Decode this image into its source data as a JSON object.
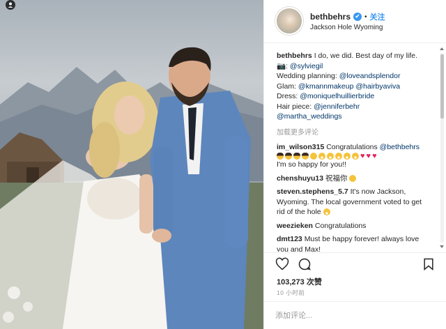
{
  "post": {
    "username": "bethbehrs",
    "verified_mark": "✔",
    "separator": "•",
    "follow_label": "关注",
    "location": "Jackson Hole Wyoming"
  },
  "caption": {
    "username": "bethbehrs",
    "text": "I do, we did. Best day of my life.",
    "camera_emoji": "📷",
    "lines": [
      {
        "prefix": "📷: ",
        "link": "@sylviegil"
      },
      {
        "prefix": "Wedding planning: ",
        "link": "@loveandsplendor"
      },
      {
        "prefix": "Glam: ",
        "link": "@kmannmakeup @hairbyaviva"
      },
      {
        "prefix": "Dress: ",
        "link": "@moniquelhuillierbride"
      },
      {
        "prefix": "Hair piece: ",
        "link": "@jenniferbehr"
      },
      {
        "prefix": "",
        "link": "@martha_weddings"
      }
    ]
  },
  "load_more_label": "加载更多评论",
  "comments": [
    {
      "username": "im_wilson315",
      "text_before": "Congratulations ",
      "link": "@bethbehrs",
      "text_after": "I'm so happy for you!!",
      "emoji_line": true
    },
    {
      "username": "chenshuyu13",
      "text_before": "祝福你",
      "link": "",
      "text_after": ""
    },
    {
      "username": "steven.stephens_5.7",
      "text_before": "It's now Jackson, Wyoming. The local government voted to get rid of the hole",
      "link": "",
      "text_after": ""
    },
    {
      "username": "weezieken",
      "text_before": "Congratulations",
      "link": "",
      "text_after": ""
    },
    {
      "username": "dmt123",
      "text_before": "Must be happy forever! always love you and Max!",
      "link": "",
      "text_after": ""
    }
  ],
  "likes_count": "103,273",
  "likes_label": "次赞",
  "timestamp": "10 小时前",
  "add_comment_placeholder": "添加评论...",
  "colors": {
    "link": "#003569",
    "follow": "#3897f0",
    "verified": "#3897f0",
    "muted": "#999999"
  },
  "icons": [
    "heart-icon",
    "comment-icon",
    "bookmark-icon",
    "verified-icon",
    "profile-tag-icon"
  ]
}
